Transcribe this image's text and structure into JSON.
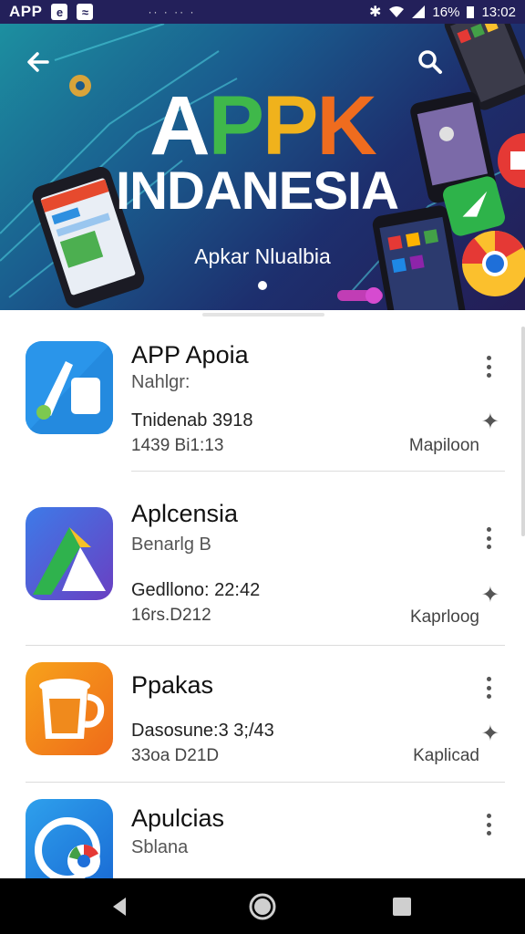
{
  "status_bar": {
    "app_label": "APP",
    "icon1": "e",
    "icon2": "≈",
    "dots": "·· · ·· ·",
    "battery": "16%",
    "time": "13:02",
    "icons": [
      "bluetooth-icon",
      "wifi-icon",
      "signal-icon",
      "battery-icon"
    ]
  },
  "banner": {
    "title_part1": "A",
    "title_part2": "P",
    "title_part3": "P",
    "title_part4": "K",
    "title_line2": "INDANESIA",
    "subtitle": "Apkar Nlualbia",
    "icons": [
      "back-arrow-icon",
      "search-icon"
    ]
  },
  "apps": [
    {
      "name": "APP Apoia",
      "sub": "Nahlgr:",
      "line1": "Tnidenab 3918",
      "line2": "1439 Bi1:13",
      "action": "Mapiloon",
      "icon": "document-app-icon"
    },
    {
      "name": "Aplcensia",
      "sub": "Benarlg B",
      "line1": "Gedllono: 22:42",
      "line2": "16rs.D212",
      "action": "Kaprloog",
      "icon": "triangle-app-icon"
    },
    {
      "name": "Ppakas",
      "sub": "",
      "line1": "Dasosune:3 3;/43",
      "line2": "33oa D21D",
      "action": "Kaplicad",
      "icon": "mug-app-icon"
    },
    {
      "name": "Apulcias",
      "sub": "Sblana",
      "line1": "",
      "line2": "",
      "action": "",
      "icon": "chrome-app-icon"
    }
  ],
  "colors": {
    "status_bar_bg": "#23205a",
    "title_green": "#3fb84a",
    "title_yellow": "#f0b21c",
    "title_orange": "#ef6c1e"
  },
  "nav_bar": {
    "icons": [
      "back-triangle-icon",
      "home-circle-icon",
      "recents-square-icon"
    ]
  }
}
